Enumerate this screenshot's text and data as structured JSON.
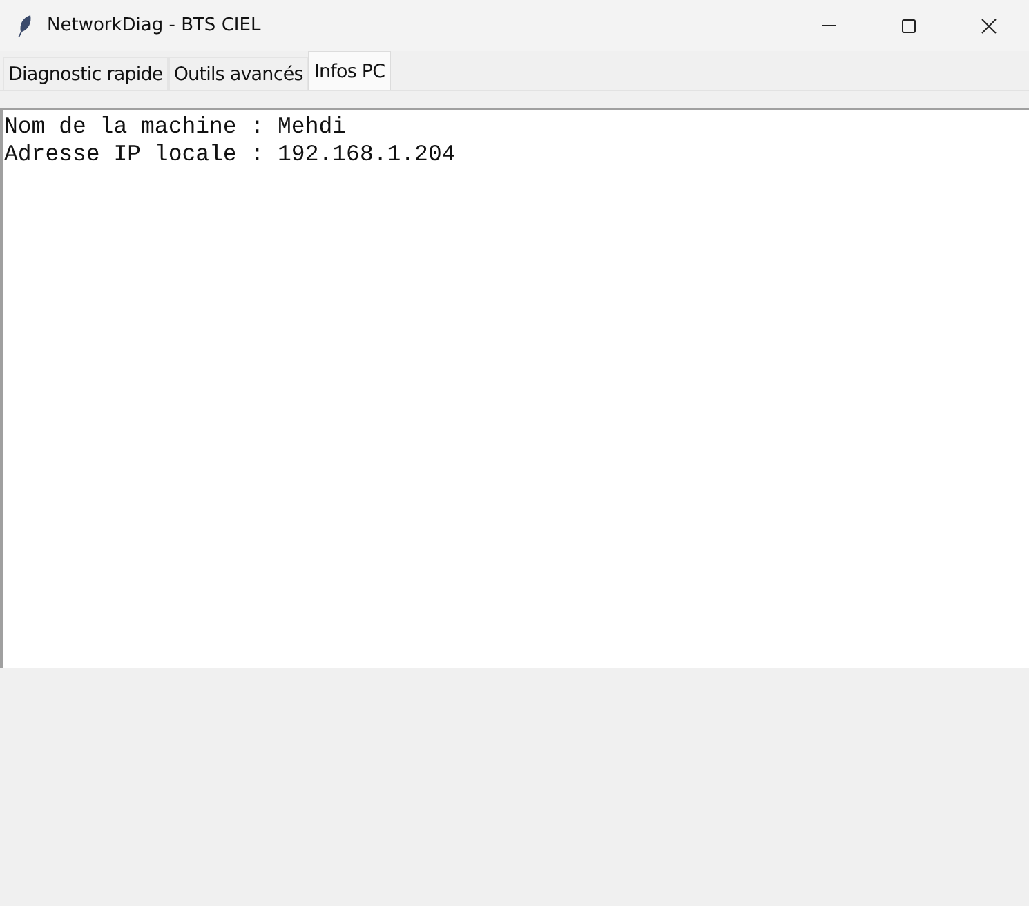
{
  "window": {
    "title": "NetworkDiag - BTS CIEL"
  },
  "tabs": [
    {
      "label": "Diagnostic rapide",
      "selected": false
    },
    {
      "label": "Outils avancés",
      "selected": false
    },
    {
      "label": "Infos PC",
      "selected": true
    }
  ],
  "output": {
    "lines": [
      "Nom de la machine : Mehdi",
      "Adresse IP locale : 192.168.1.204"
    ]
  }
}
